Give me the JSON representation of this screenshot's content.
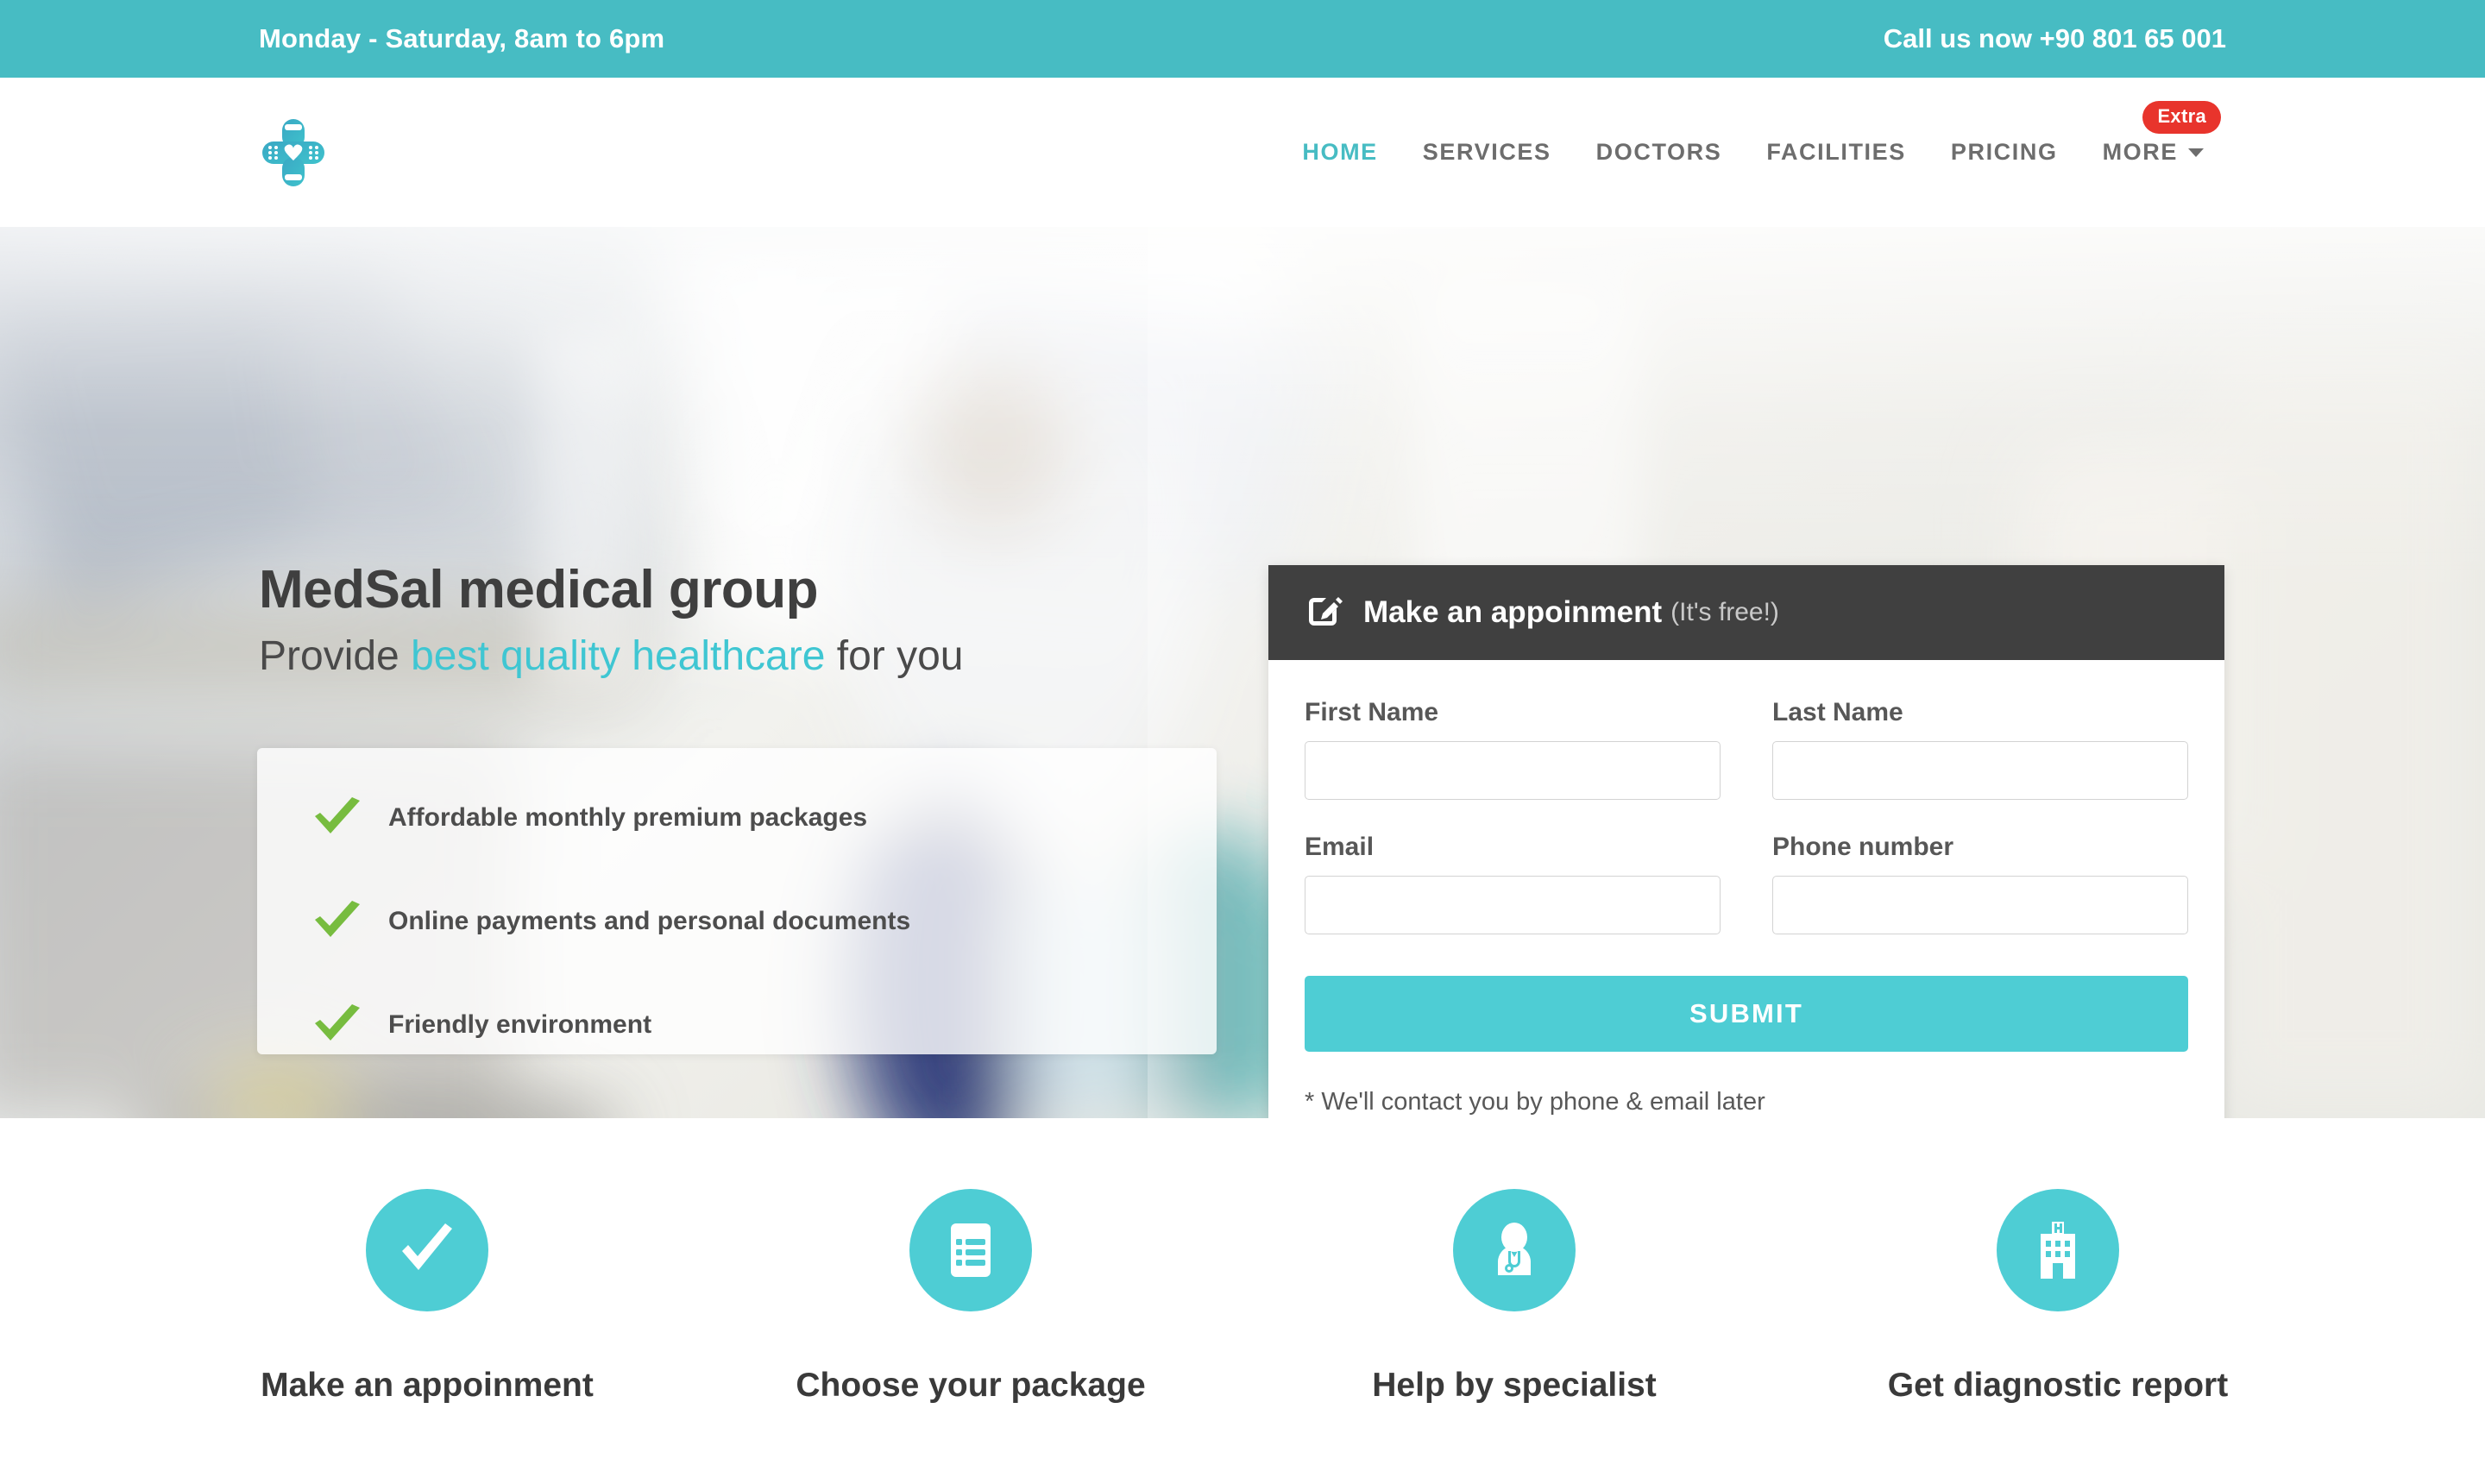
{
  "topbar": {
    "hours": "Monday - Saturday, 8am to 6pm",
    "call": "Call us now +90 801 65 001"
  },
  "nav": {
    "logo_name": "medsal-logo",
    "items": [
      {
        "label": "HOME",
        "active": true
      },
      {
        "label": "SERVICES",
        "active": false
      },
      {
        "label": "DOCTORS",
        "active": false
      },
      {
        "label": "FACILITIES",
        "active": false
      },
      {
        "label": "PRICING",
        "active": false
      }
    ],
    "more_label": "MORE",
    "extra_badge": "Extra"
  },
  "hero": {
    "title": "MedSal medical group",
    "sub_before": "Provide ",
    "sub_highlight": "best quality healthcare",
    "sub_after": " for you",
    "features": [
      "Affordable monthly premium packages",
      "Online payments and personal documents",
      "Friendly environment"
    ]
  },
  "appointment": {
    "title": "Make an appoinment",
    "free_note": "(It's free!)",
    "fields": [
      {
        "label": "First Name",
        "value": "",
        "placeholder": ""
      },
      {
        "label": "Last Name",
        "value": "",
        "placeholder": ""
      },
      {
        "label": "Email",
        "value": "",
        "placeholder": ""
      },
      {
        "label": "Phone number",
        "value": "",
        "placeholder": ""
      }
    ],
    "submit_label": "SUBMIT",
    "note": "* We'll contact you by phone & email later"
  },
  "strip": {
    "items": [
      {
        "label": "Make an appoinment",
        "icon": "check-icon"
      },
      {
        "label": "Choose your package",
        "icon": "list-document-icon"
      },
      {
        "label": "Help by specialist",
        "icon": "doctor-stethoscope-icon"
      },
      {
        "label": "Get diagnostic report",
        "icon": "hospital-building-icon"
      }
    ]
  },
  "colors": {
    "teal": "#4ecdd4",
    "teal_bar": "#47bcc3",
    "dark": "#404040",
    "red_badge": "#e8342c",
    "green_check": "#77bc3f"
  }
}
